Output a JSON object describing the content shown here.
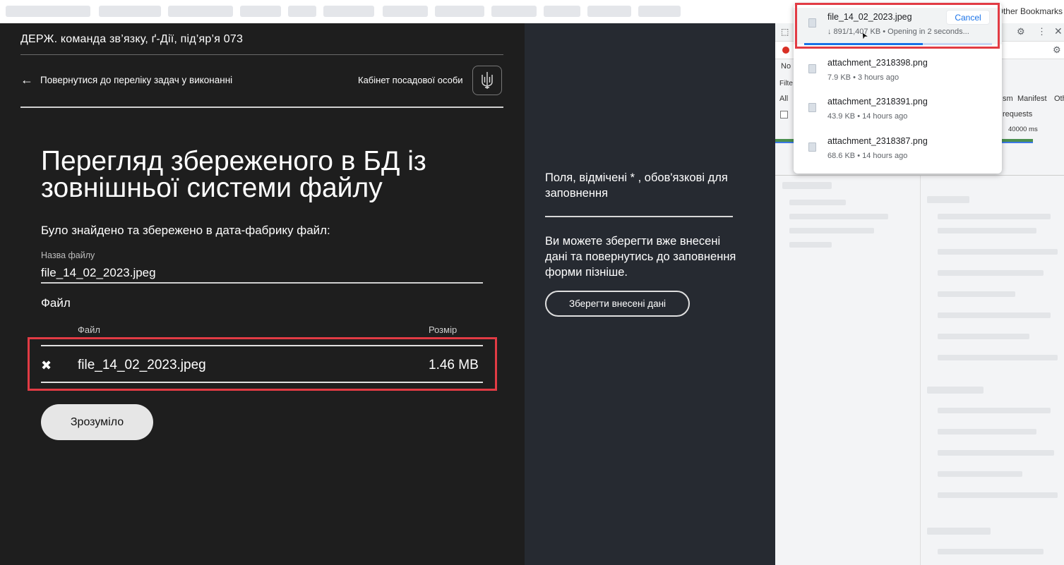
{
  "bookmarks_bar": {
    "other_bookmarks": "Other Bookmarks"
  },
  "header": {
    "title": "ДЕРЖ. команда зв’язку, ґ-Дії, під’яр’я 073",
    "back_link": "Повернутися до переліку задач у виконанні",
    "cabinet": "Кабінет посадової особи"
  },
  "main": {
    "title": "Перегляд збереженого в БД із зовнішньої системи файлу",
    "found_text": "Було знайдено та збережено в дата-фабрику файл:",
    "filename_label": "Назва файлу",
    "filename_value": "file_14_02_2023.jpeg",
    "file_section_label": "Файл",
    "table": {
      "columns": [
        "Файл",
        "Розмір"
      ],
      "rows": [
        {
          "name": "file_14_02_2023.jpeg",
          "size": "1.46 MB"
        }
      ]
    },
    "ok_button": "Зрозуміло"
  },
  "side": {
    "required_note": "Поля, відмічені * , обов'язкові для заповнення",
    "save_note": "Ви можете зберегти вже внесені дані та повернутись до заповнення форми пізніше.",
    "save_button": "Зберегти внесені дані"
  },
  "devtools": {
    "no_label": "No",
    "filter_label": "Filte",
    "all_tab": "All",
    "tab_sm": "sm",
    "tab_manifest": "Manifest",
    "tab_other": "Oth",
    "requests_label": "requests",
    "timeline_label": "40000 ms"
  },
  "downloads": {
    "items": [
      {
        "name": "file_14_02_2023.jpeg",
        "meta": "↓ 891/1,407 KB • Opening in 2 seconds...",
        "cancel": "Cancel",
        "progress": 0.63
      },
      {
        "name": "attachment_2318398.png",
        "meta": "7.9 KB • 3 hours ago"
      },
      {
        "name": "attachment_2318391.png",
        "meta": "43.9 KB • 14 hours ago"
      },
      {
        "name": "attachment_2318387.png",
        "meta": "68.6 KB • 14 hours ago"
      }
    ]
  },
  "colors": {
    "highlight": "#e23b44",
    "progress": "#1a73e8",
    "page_bg": "#1e1e1e",
    "side_bg": "#262a31"
  }
}
